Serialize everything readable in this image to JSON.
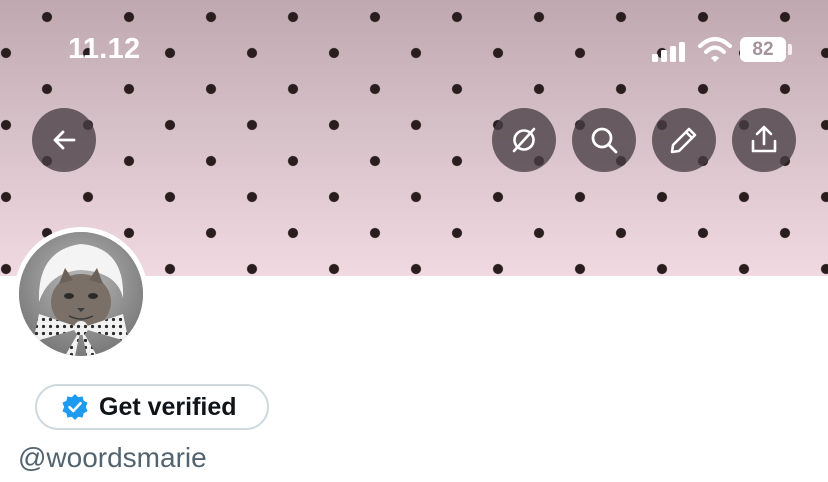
{
  "status_bar": {
    "time": "11.12",
    "battery_level": "82",
    "signal_bars": 4,
    "icons": [
      "signal-icon",
      "wifi-icon",
      "battery-icon"
    ]
  },
  "header": {
    "banner_pattern": "polka-dot",
    "banner_colors": {
      "dot": "#2a1d1e",
      "top": "#bfa8b0",
      "bottom": "#f0d9e1"
    },
    "buttons": [
      {
        "icon": "back-arrow-icon"
      },
      {
        "icon": "grok-icon"
      },
      {
        "icon": "search-icon"
      },
      {
        "icon": "pencil-icon"
      },
      {
        "icon": "share-icon"
      }
    ]
  },
  "profile": {
    "avatar_alt": "cat wearing a white bonnet",
    "verify_button": {
      "label": "Get verified",
      "icon": "verified-badge-icon",
      "badge_color": "#1d9bf0"
    },
    "handle": "@woordsmarie"
  }
}
